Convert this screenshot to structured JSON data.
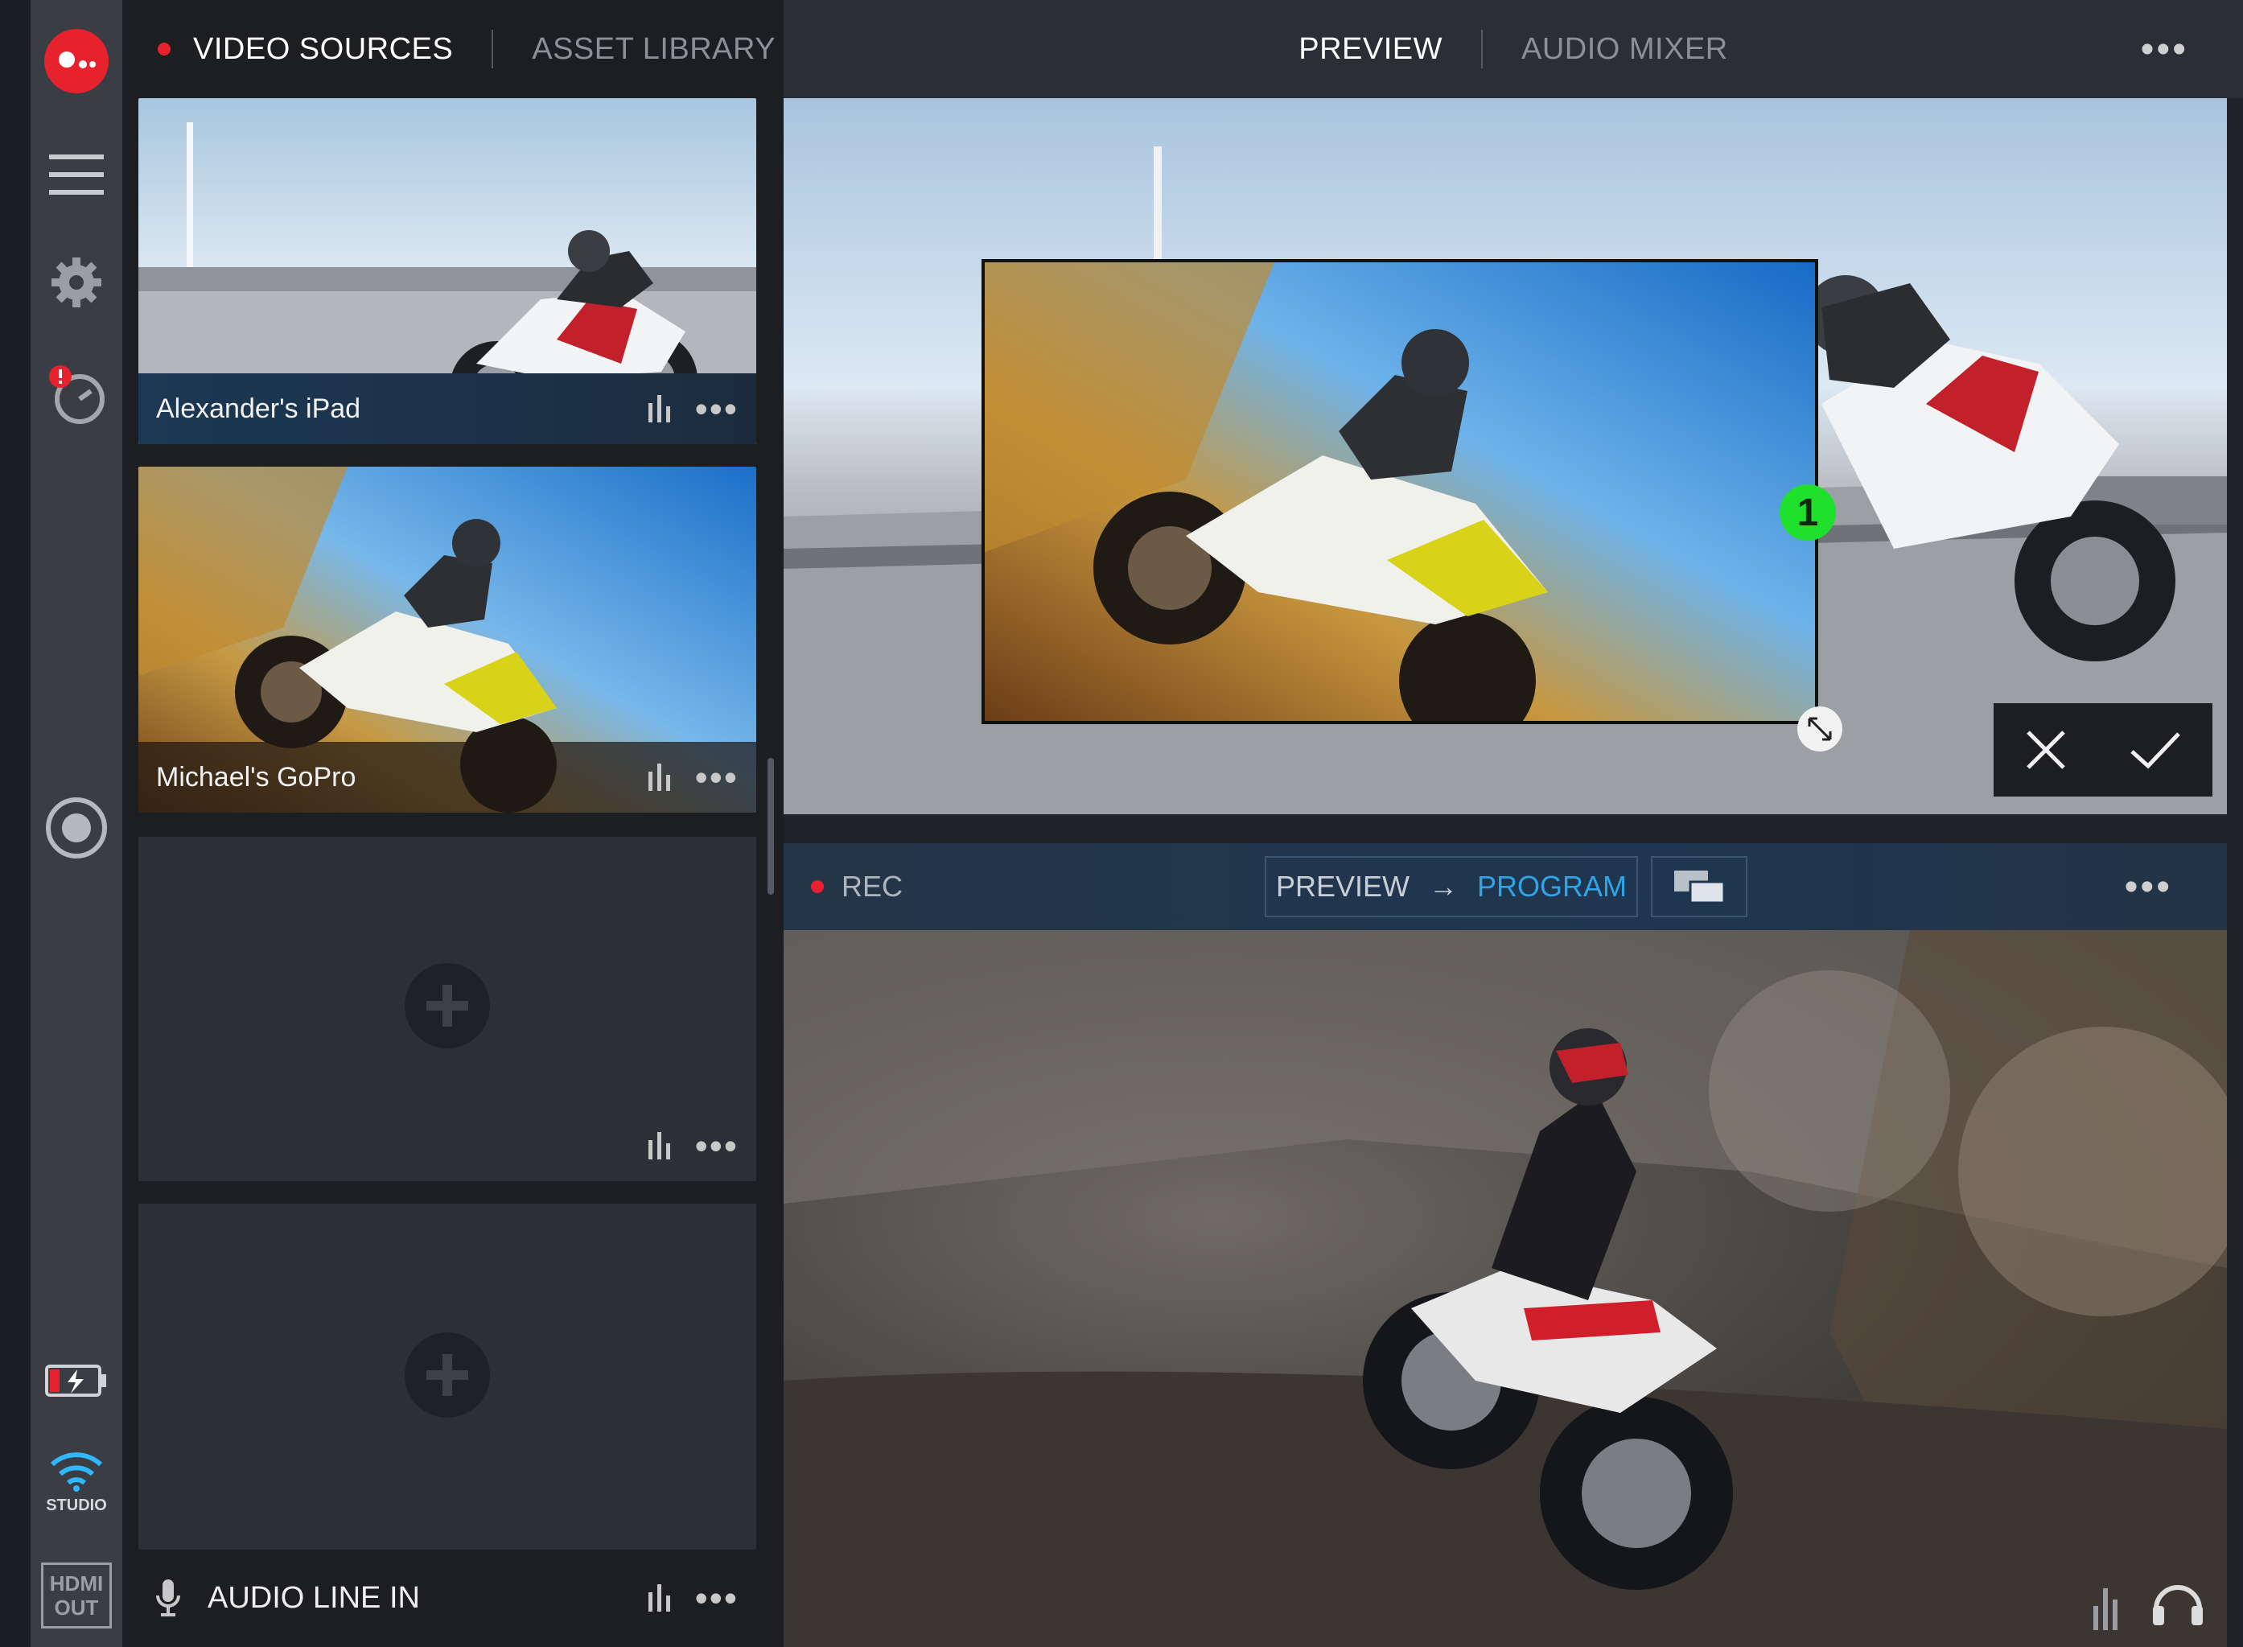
{
  "rail": {
    "logo_icon": "app-logo-icon",
    "menu_icon": "hamburger-menu-icon",
    "settings_icon": "gear-icon",
    "timer_icon": "timer-alert-icon",
    "record_icon": "record-target-icon",
    "battery_icon": "battery-charging-icon",
    "wifi_label": "STUDIO",
    "hdmi_line1": "HDMI",
    "hdmi_line2": "OUT"
  },
  "sources": {
    "tabs": [
      {
        "label": "VIDEO SOURCES",
        "active": true
      },
      {
        "label": "ASSET LIBRARY",
        "active": false
      }
    ],
    "tiles": [
      {
        "name": "Alexander's iPad"
      },
      {
        "name": "Michael's GoPro"
      },
      {
        "name": ""
      },
      {
        "name": ""
      }
    ],
    "audio_line_in": "AUDIO LINE IN"
  },
  "header": {
    "tabs": [
      {
        "label": "PREVIEW",
        "active": true
      },
      {
        "label": "AUDIO MIXER",
        "active": false
      }
    ]
  },
  "preview": {
    "layer_badge": "1"
  },
  "program": {
    "rec_label": "REC",
    "transition_from": "PREVIEW",
    "transition_arrow": "→",
    "transition_to": "PROGRAM"
  },
  "colors": {
    "accent_red": "#e8222c",
    "program_blue": "#2ea3e6",
    "badge_green": "#1fe02c",
    "wifi_blue": "#2fb7ff"
  }
}
